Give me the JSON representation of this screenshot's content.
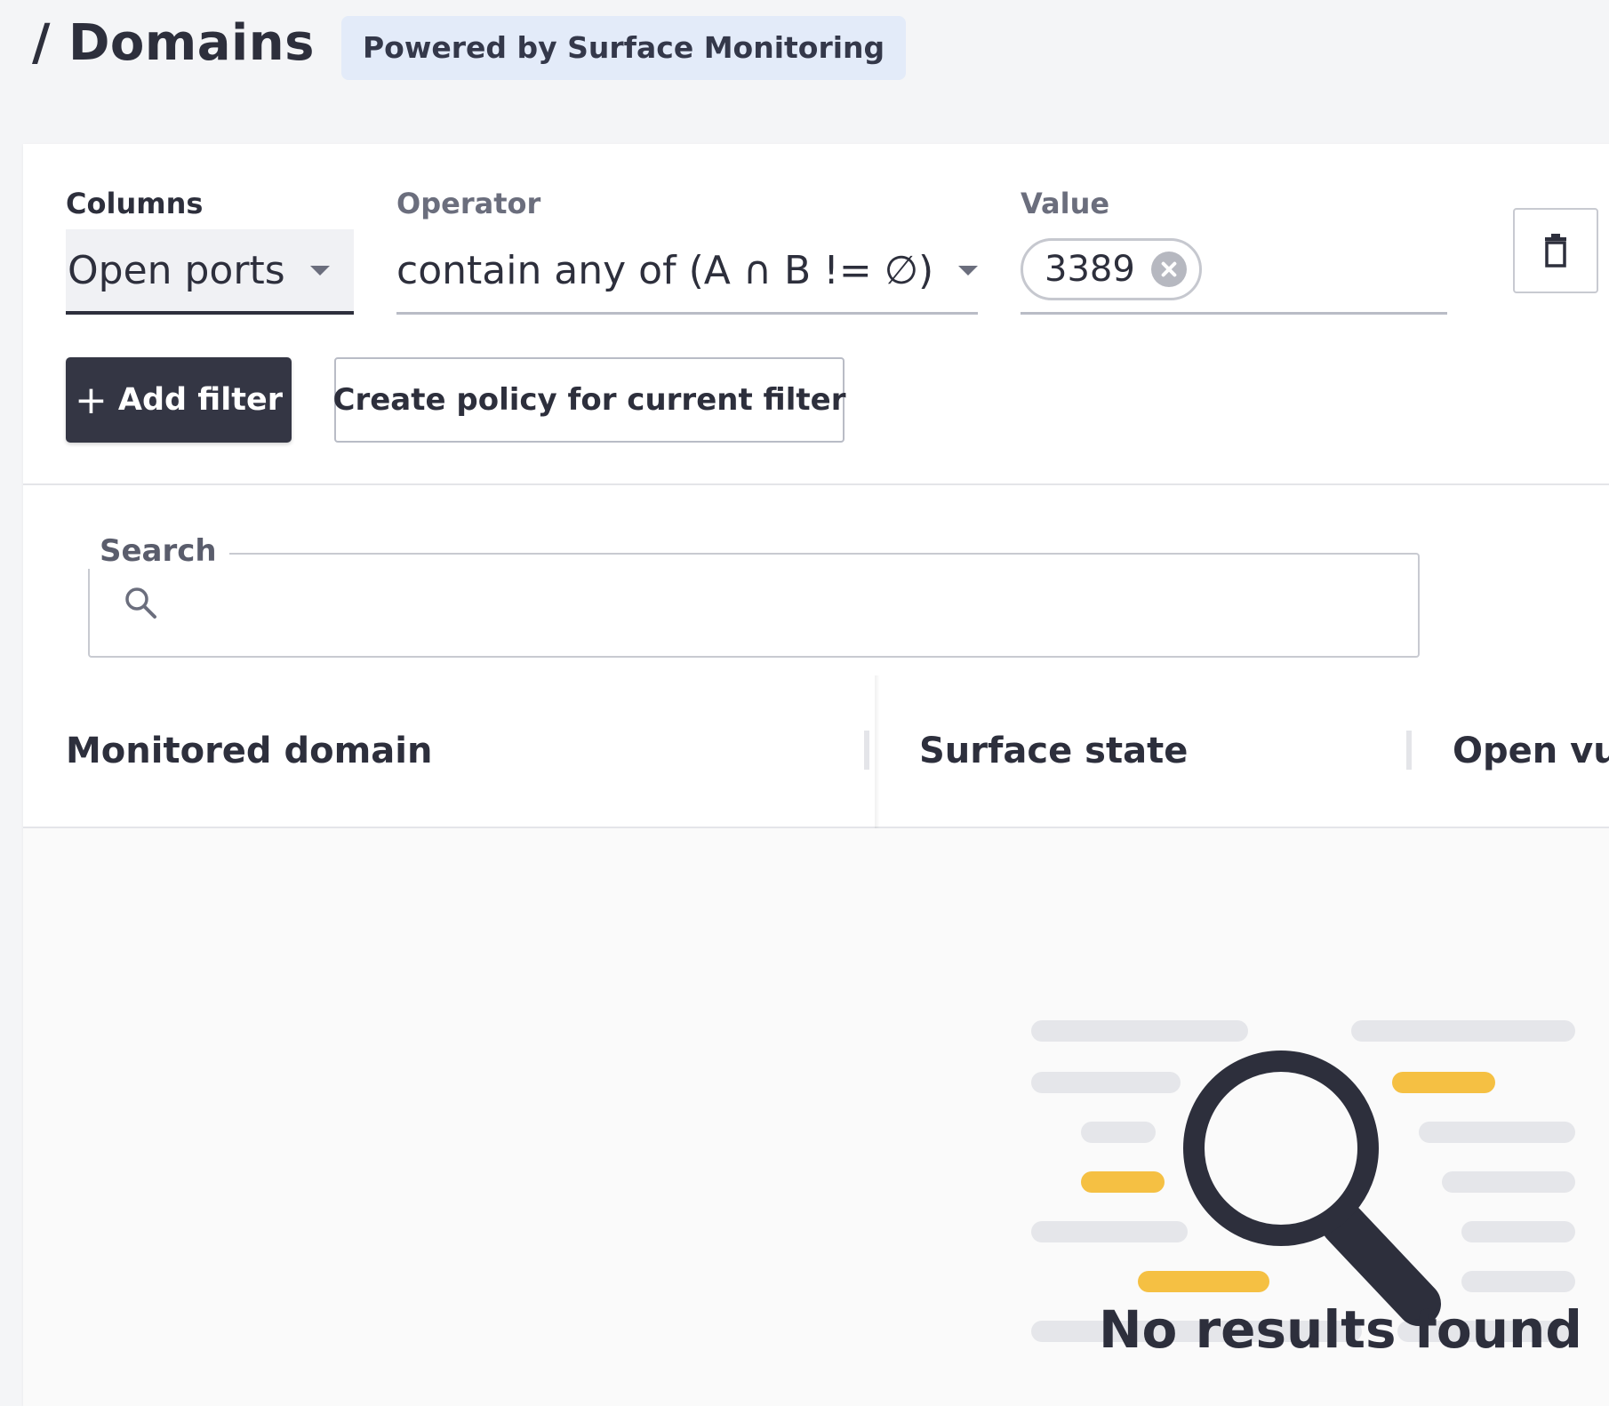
{
  "header": {
    "title": "/ Domains",
    "badge": "Powered by Surface Monitoring"
  },
  "filter": {
    "columns_label": "Columns",
    "columns_value": "Open ports",
    "operator_label": "Operator",
    "operator_value": "contain any of (A ∩ B != ∅)",
    "value_label": "Value",
    "value_chip": "3389",
    "add_filter_label": "Add filter",
    "create_policy_label": "Create policy for current filter"
  },
  "search": {
    "label": "Search",
    "value": ""
  },
  "table": {
    "columns": [
      "Monitored domain",
      "Surface state",
      "Open vul"
    ]
  },
  "empty_state": {
    "message": "No results found"
  },
  "colors": {
    "primary": "#343644",
    "badge_bg": "#e3ebf9",
    "accent_yellow": "#f5c043",
    "placeholder_gray": "#e5e6ea"
  }
}
